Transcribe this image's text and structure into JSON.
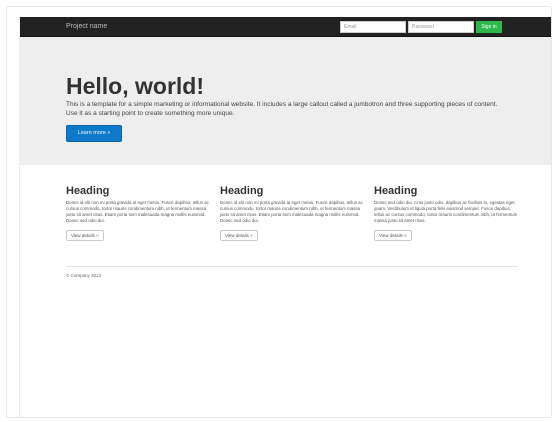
{
  "navbar": {
    "brand": "Project name",
    "email_placeholder": "Email",
    "password_placeholder": "Password",
    "signin_label": "Sign in"
  },
  "jumbotron": {
    "title": "Hello, world!",
    "lead": "This is a template for a simple marketing or informational website. It includes a large callout called a jumbotron and three supporting pieces of content. Use it as a starting point to create something more unique.",
    "button_label": "Learn more »"
  },
  "columns": [
    {
      "heading": "Heading",
      "text": "Donec id elit non mi porta gravida at eget metus. Fusce dapibus, tellus ac cursus commodo, tortor mauris condimentum nibh, ut fermentum massa justo sit amet risus. Etiam porta sem malesuada magna mollis euismod. Donec sed odio dui.",
      "button_label": "View details »"
    },
    {
      "heading": "Heading",
      "text": "Donec id elit non mi porta gravida at eget metus. Fusce dapibus, tellus ac cursus commodo, tortor mauris condimentum nibh, ut fermentum massa justo sit amet risus. Etiam porta sem malesuada magna mollis euismod. Donec sed odio dui.",
      "button_label": "View details »"
    },
    {
      "heading": "Heading",
      "text": "Donec sed odio dui. Cras justo odio, dapibus ac facilisis in, egestas eget quam. Vestibulum id ligula porta felis euismod semper. Fusce dapibus, tellus ac cursus commodo, tortor mauris condimentum nibh, ut fermentum massa justo sit amet risus.",
      "button_label": "View details »"
    }
  ],
  "footer": {
    "text": "© Company 2013"
  }
}
